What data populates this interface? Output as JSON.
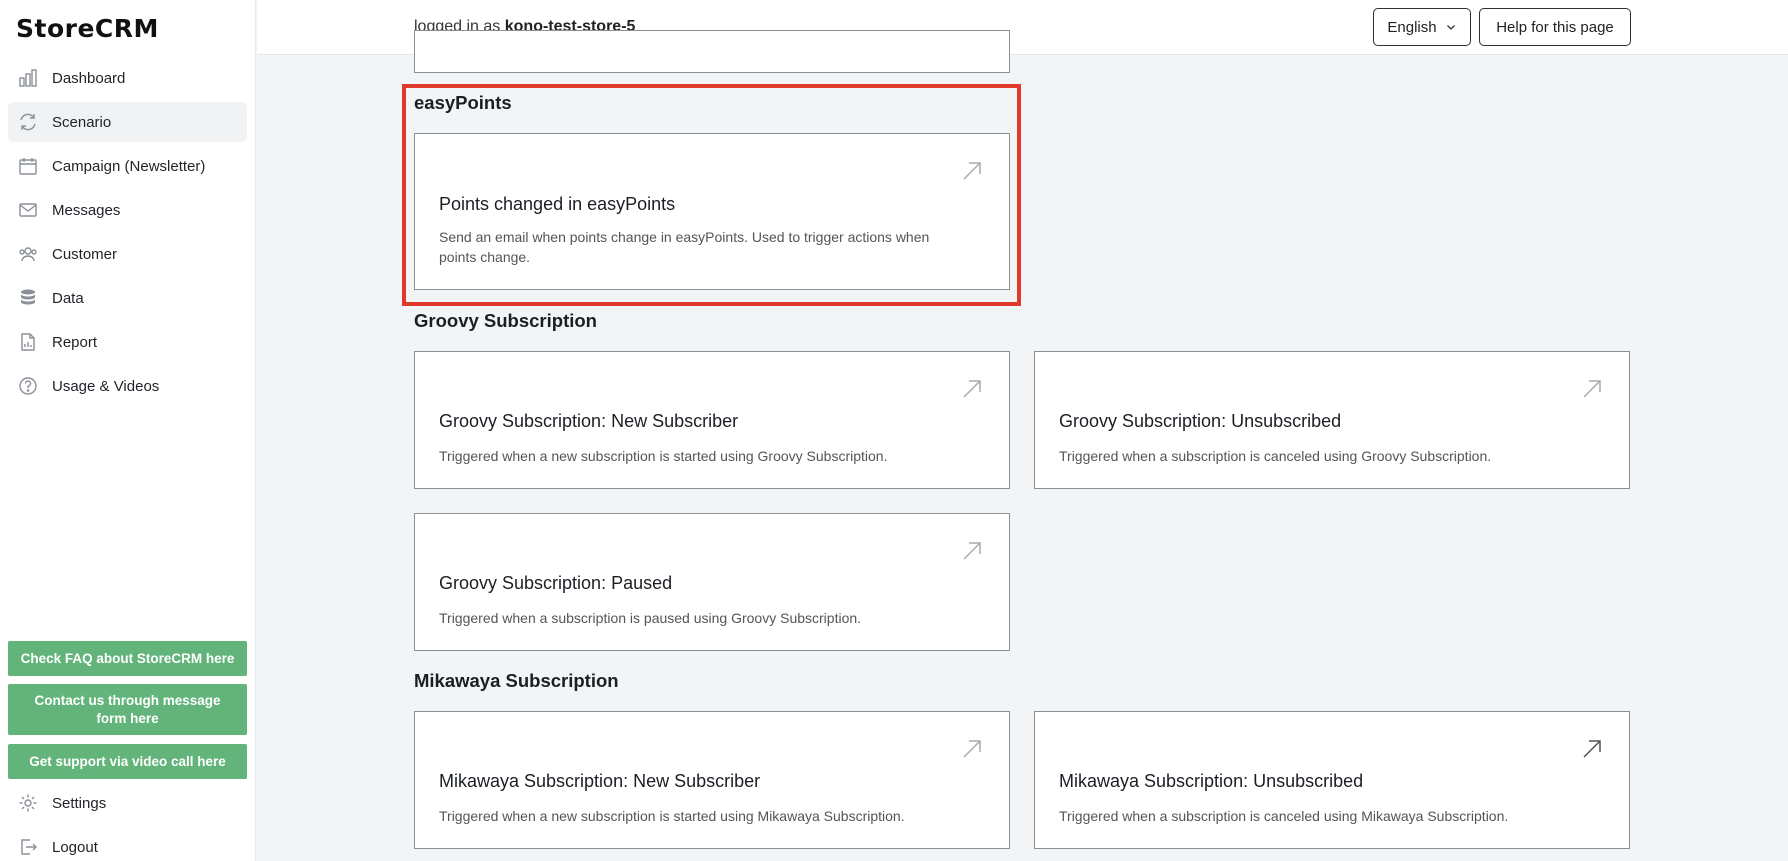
{
  "app": {
    "logo": "StoreCRM"
  },
  "sidebar": {
    "items": [
      {
        "label": "Dashboard",
        "icon": "bar-chart-icon"
      },
      {
        "label": "Scenario",
        "icon": "refresh-icon"
      },
      {
        "label": "Campaign (Newsletter)",
        "icon": "calendar-icon"
      },
      {
        "label": "Messages",
        "icon": "mail-icon"
      },
      {
        "label": "Customer",
        "icon": "users-icon"
      },
      {
        "label": "Data",
        "icon": "database-icon"
      },
      {
        "label": "Report",
        "icon": "report-icon"
      },
      {
        "label": "Usage & Videos",
        "icon": "help-circle-icon"
      }
    ],
    "support_buttons": [
      "Check FAQ about StoreCRM here",
      "Contact us through message form here",
      "Get support via video call here"
    ],
    "bottom": [
      {
        "label": "Settings",
        "icon": "gear-icon"
      },
      {
        "label": "Logout",
        "icon": "logout-icon"
      }
    ]
  },
  "topbar": {
    "login_prefix": "logged in as",
    "store_name": "kono-test-store-5",
    "language": "English",
    "help_label": "Help for this page"
  },
  "sections": [
    {
      "title": "easyPoints",
      "cards": [
        {
          "title": "Points changed in easyPoints",
          "desc": "Send an email when points change in easyPoints. Used to trigger actions when points change."
        }
      ]
    },
    {
      "title": "Groovy Subscription",
      "cards": [
        {
          "title": "Groovy Subscription: New Subscriber",
          "desc": "Triggered when a new subscription is started using Groovy Subscription."
        },
        {
          "title": "Groovy Subscription: Unsubscribed",
          "desc": "Triggered when a subscription is canceled using Groovy Subscription."
        },
        {
          "title": "Groovy Subscription: Paused",
          "desc": "Triggered when a subscription is paused using Groovy Subscription."
        }
      ]
    },
    {
      "title": "Mikawaya Subscription",
      "cards": [
        {
          "title": "Mikawaya Subscription: New Subscriber",
          "desc": "Triggered when a new subscription is started using Mikawaya Subscription."
        },
        {
          "title": "Mikawaya Subscription: Unsubscribed",
          "desc": "Triggered when a subscription is canceled using Mikawaya Subscription."
        }
      ]
    }
  ],
  "colors": {
    "support_green": "#62b47a",
    "highlight_red": "#e03a2c"
  }
}
